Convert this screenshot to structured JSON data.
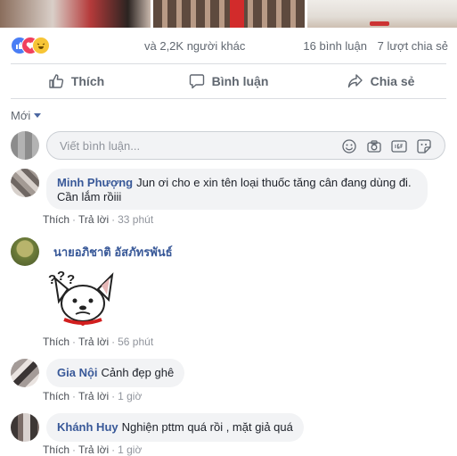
{
  "reactions": {
    "icons": [
      "like-icon",
      "love-icon",
      "haha-icon"
    ],
    "text": "và 2,2K người khác",
    "comments_count": "16 bình luận",
    "shares_count": "7 lượt chia sẻ"
  },
  "actions": {
    "like": "Thích",
    "comment": "Bình luận",
    "share": "Chia sẻ"
  },
  "sort": {
    "label": "Mới"
  },
  "composer": {
    "placeholder": "Viết bình luận...",
    "icons": [
      "emoji-icon",
      "camera-icon",
      "gif-icon",
      "sticker-icon"
    ]
  },
  "comments": [
    {
      "author": "Minh Phượng",
      "text": "Jun ơi cho e xin tên loại thuốc tăng cân đang dùng đi. Cần lắm rồiii",
      "like": "Thích",
      "reply": "Trả lời",
      "time": "33 phút"
    },
    {
      "author": "นายอภิชาติ อัสภัทรพันธ์",
      "text": "",
      "like": "Thích",
      "reply": "Trả lời",
      "time": "56 phút"
    },
    {
      "author": "Gia Nội",
      "text": "Cảnh đẹp ghê",
      "like": "Thích",
      "reply": "Trả lời",
      "time": "1 giờ"
    },
    {
      "author": "Khánh Huy",
      "text": "Nghiện pttm quá rồi , mặt giả quá",
      "like": "Thích",
      "reply": "Trả lời",
      "time": "1 giờ"
    }
  ],
  "colors": {
    "link": "#385898",
    "meta": "#90949c",
    "bubble": "#f2f3f5",
    "like_blue": "#4a7ef5",
    "love_red": "#f0405e",
    "haha_yellow": "#f7c536"
  }
}
